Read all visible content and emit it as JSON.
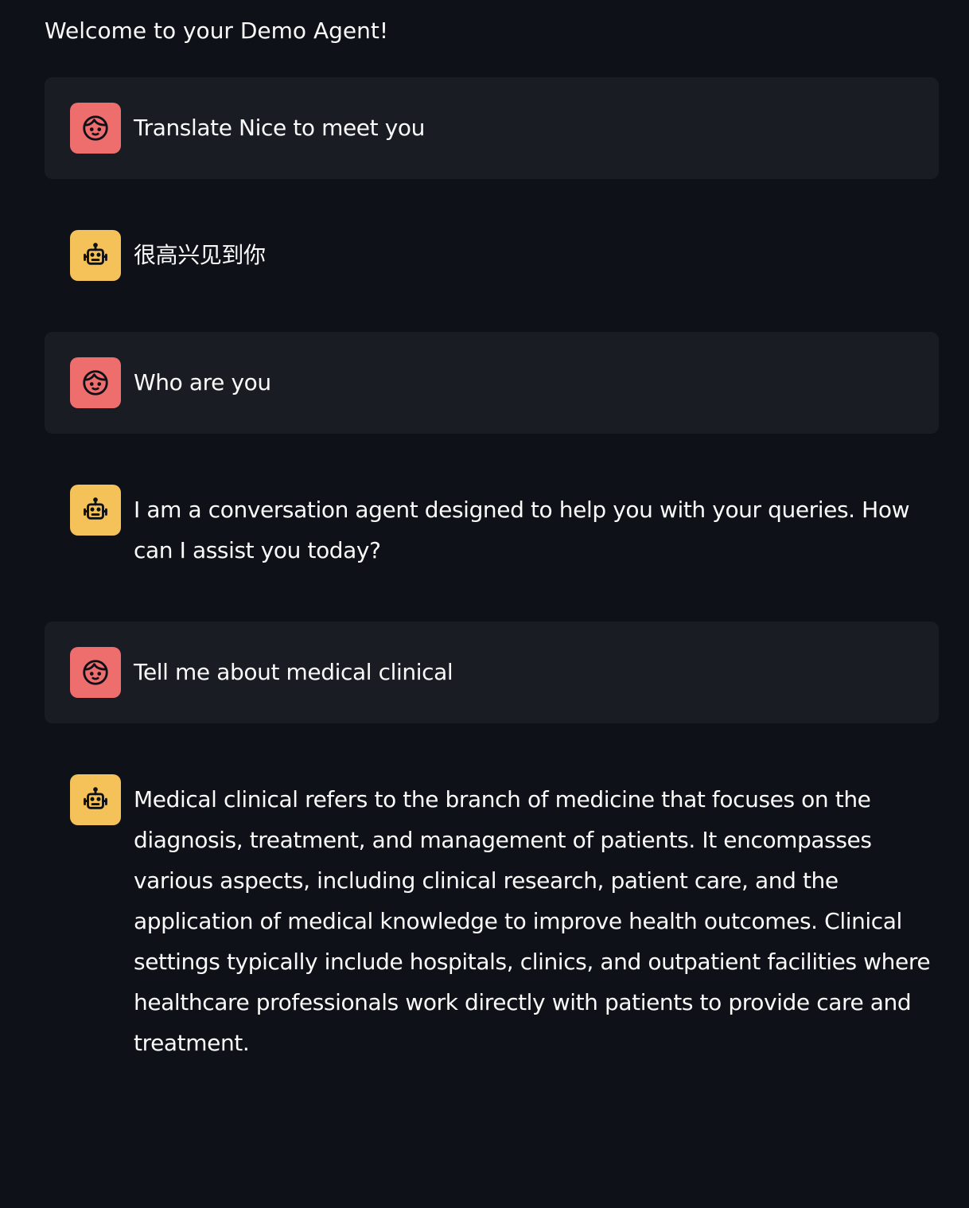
{
  "app": {
    "welcome": "Welcome to your Demo Agent!"
  },
  "icons": {
    "user_avatar": "user-face-icon",
    "assistant_avatar": "robot-icon"
  },
  "colors": {
    "background": "#0e1117",
    "user_message_bg": "#1a1c24",
    "user_avatar": "#ee6e6e",
    "assistant_avatar": "#f5c159",
    "text": "#fafafa"
  },
  "messages": [
    {
      "role": "user",
      "text": "Translate Nice to meet you"
    },
    {
      "role": "assistant",
      "text": "很高兴见到你"
    },
    {
      "role": "user",
      "text": "Who are you"
    },
    {
      "role": "assistant",
      "text": "I am a conversation agent designed to help you with your queries. How can I assist you today?"
    },
    {
      "role": "user",
      "text": "Tell me about medical clinical"
    },
    {
      "role": "assistant",
      "text": "Medical clinical refers to the branch of medicine that focuses on the diagnosis, treatment, and management of patients. It encompasses various aspects, including clinical research, patient care, and the application of medical knowledge to improve health outcomes. Clinical settings typically include hospitals, clinics, and outpatient facilities where healthcare professionals work directly with patients to provide care and treatment."
    }
  ]
}
